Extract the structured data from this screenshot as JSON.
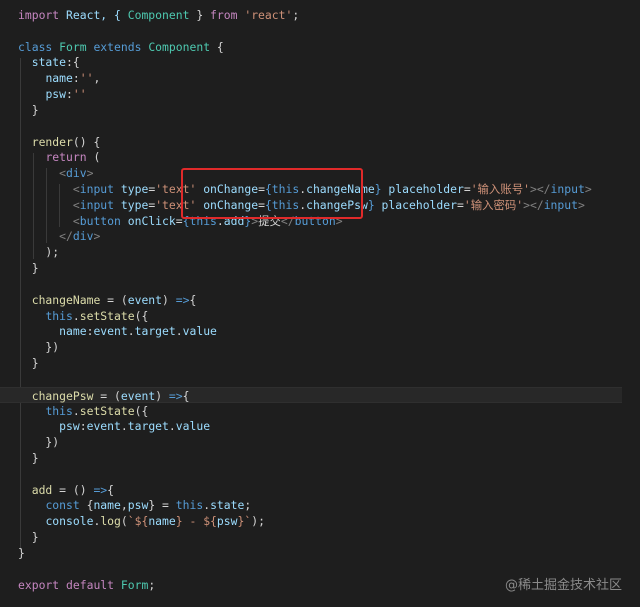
{
  "colors": {
    "background": "#1e1e1e",
    "keyword": "#569cd6",
    "control": "#c586c0",
    "type": "#4ec9b0",
    "variable": "#9cdcfe",
    "function": "#dcdcaa",
    "string": "#ce9178",
    "text": "#d4d4d4",
    "tag": "#569cd6",
    "tag_bracket": "#808080",
    "highlight_box": "#e02a2a"
  },
  "code_lines": [
    [
      [
        "import",
        "control"
      ],
      [
        " React, { ",
        "variable"
      ],
      [
        "Component",
        "type"
      ],
      [
        " } ",
        "text"
      ],
      [
        "from",
        "control"
      ],
      [
        " ",
        "text"
      ],
      [
        "'react'",
        "string"
      ],
      [
        ";",
        "text"
      ]
    ],
    [],
    [
      [
        "class",
        "keyword"
      ],
      [
        " ",
        "text"
      ],
      [
        "Form",
        "type"
      ],
      [
        " ",
        "text"
      ],
      [
        "extends",
        "keyword"
      ],
      [
        " ",
        "text"
      ],
      [
        "Component",
        "type"
      ],
      [
        " {",
        "text"
      ]
    ],
    [
      [
        "  ",
        "text"
      ],
      [
        "state",
        "variable"
      ],
      [
        ":{",
        "text"
      ]
    ],
    [
      [
        "    ",
        "text"
      ],
      [
        "name",
        "variable"
      ],
      [
        ":",
        "text"
      ],
      [
        "''",
        "string"
      ],
      [
        ",",
        "text"
      ]
    ],
    [
      [
        "    ",
        "text"
      ],
      [
        "psw",
        "variable"
      ],
      [
        ":",
        "text"
      ],
      [
        "''",
        "string"
      ]
    ],
    [
      [
        "  }",
        "text"
      ]
    ],
    [],
    [
      [
        "  ",
        "text"
      ],
      [
        "render",
        "function"
      ],
      [
        "() {",
        "text"
      ]
    ],
    [
      [
        "    ",
        "text"
      ],
      [
        "return",
        "control"
      ],
      [
        " (",
        "text"
      ]
    ],
    [
      [
        "      ",
        "text"
      ],
      [
        "<",
        "tag_bracket"
      ],
      [
        "div",
        "tag"
      ],
      [
        ">",
        "tag_bracket"
      ]
    ],
    [
      [
        "        ",
        "text"
      ],
      [
        "<",
        "tag_bracket"
      ],
      [
        "input",
        "tag"
      ],
      [
        " ",
        "text"
      ],
      [
        "type",
        "variable"
      ],
      [
        "=",
        "text"
      ],
      [
        "'text'",
        "string"
      ],
      [
        " ",
        "text"
      ],
      [
        "onChange",
        "variable"
      ],
      [
        "=",
        "text"
      ],
      [
        "{",
        "keyword"
      ],
      [
        "this",
        "keyword"
      ],
      [
        ".",
        "text"
      ],
      [
        "changeName",
        "variable"
      ],
      [
        "}",
        "keyword"
      ],
      [
        " ",
        "text"
      ],
      [
        "placeholder",
        "variable"
      ],
      [
        "=",
        "text"
      ],
      [
        "'输入账号'",
        "string"
      ],
      [
        ">",
        "tag_bracket"
      ],
      [
        "</",
        "tag_bracket"
      ],
      [
        "input",
        "tag"
      ],
      [
        ">",
        "tag_bracket"
      ]
    ],
    [
      [
        "        ",
        "text"
      ],
      [
        "<",
        "tag_bracket"
      ],
      [
        "input",
        "tag"
      ],
      [
        " ",
        "text"
      ],
      [
        "type",
        "variable"
      ],
      [
        "=",
        "text"
      ],
      [
        "'text'",
        "string"
      ],
      [
        " ",
        "text"
      ],
      [
        "onChange",
        "variable"
      ],
      [
        "=",
        "text"
      ],
      [
        "{",
        "keyword"
      ],
      [
        "this",
        "keyword"
      ],
      [
        ".",
        "text"
      ],
      [
        "changePsw",
        "variable"
      ],
      [
        "}",
        "keyword"
      ],
      [
        " ",
        "text"
      ],
      [
        "placeholder",
        "variable"
      ],
      [
        "=",
        "text"
      ],
      [
        "'输入密码'",
        "string"
      ],
      [
        ">",
        "tag_bracket"
      ],
      [
        "</",
        "tag_bracket"
      ],
      [
        "input",
        "tag"
      ],
      [
        ">",
        "tag_bracket"
      ]
    ],
    [
      [
        "        ",
        "text"
      ],
      [
        "<",
        "tag_bracket"
      ],
      [
        "button",
        "tag"
      ],
      [
        " ",
        "text"
      ],
      [
        "onClick",
        "variable"
      ],
      [
        "=",
        "text"
      ],
      [
        "{",
        "keyword"
      ],
      [
        "this",
        "keyword"
      ],
      [
        ".",
        "text"
      ],
      [
        "add",
        "variable"
      ],
      [
        "}",
        "keyword"
      ],
      [
        ">",
        "tag_bracket"
      ],
      [
        "提交",
        "text"
      ],
      [
        "</",
        "tag_bracket"
      ],
      [
        "button",
        "tag"
      ],
      [
        ">",
        "tag_bracket"
      ]
    ],
    [
      [
        "      ",
        "text"
      ],
      [
        "</",
        "tag_bracket"
      ],
      [
        "div",
        "tag"
      ],
      [
        ">",
        "tag_bracket"
      ]
    ],
    [
      [
        "    );",
        "text"
      ]
    ],
    [
      [
        "  }",
        "text"
      ]
    ],
    [],
    [
      [
        "  ",
        "text"
      ],
      [
        "changeName",
        "function"
      ],
      [
        " = (",
        "text"
      ],
      [
        "event",
        "variable"
      ],
      [
        ") ",
        "text"
      ],
      [
        "=>",
        "keyword"
      ],
      [
        "{",
        "text"
      ]
    ],
    [
      [
        "    ",
        "text"
      ],
      [
        "this",
        "keyword"
      ],
      [
        ".",
        "text"
      ],
      [
        "setState",
        "function"
      ],
      [
        "({",
        "text"
      ]
    ],
    [
      [
        "      ",
        "text"
      ],
      [
        "name",
        "variable"
      ],
      [
        ":",
        "text"
      ],
      [
        "event",
        "variable"
      ],
      [
        ".",
        "text"
      ],
      [
        "target",
        "variable"
      ],
      [
        ".",
        "text"
      ],
      [
        "value",
        "variable"
      ]
    ],
    [
      [
        "    })",
        "text"
      ]
    ],
    [
      [
        "  }",
        "text"
      ]
    ],
    [],
    [
      [
        "  ",
        "text"
      ],
      [
        "changePsw",
        "function"
      ],
      [
        " = (",
        "text"
      ],
      [
        "event",
        "variable"
      ],
      [
        ") ",
        "text"
      ],
      [
        "=>",
        "keyword"
      ],
      [
        "{",
        "text"
      ]
    ],
    [
      [
        "    ",
        "text"
      ],
      [
        "this",
        "keyword"
      ],
      [
        ".",
        "text"
      ],
      [
        "setState",
        "function"
      ],
      [
        "({",
        "text"
      ]
    ],
    [
      [
        "      ",
        "text"
      ],
      [
        "psw",
        "variable"
      ],
      [
        ":",
        "text"
      ],
      [
        "event",
        "variable"
      ],
      [
        ".",
        "text"
      ],
      [
        "target",
        "variable"
      ],
      [
        ".",
        "text"
      ],
      [
        "value",
        "variable"
      ]
    ],
    [
      [
        "    })",
        "text"
      ]
    ],
    [
      [
        "  }",
        "text"
      ]
    ],
    [],
    [
      [
        "  ",
        "text"
      ],
      [
        "add",
        "function"
      ],
      [
        " = () ",
        "text"
      ],
      [
        "=>",
        "keyword"
      ],
      [
        "{",
        "text"
      ]
    ],
    [
      [
        "    ",
        "text"
      ],
      [
        "const",
        "keyword"
      ],
      [
        " {",
        "text"
      ],
      [
        "name",
        "variable"
      ],
      [
        ",",
        "text"
      ],
      [
        "psw",
        "variable"
      ],
      [
        "} = ",
        "text"
      ],
      [
        "this",
        "keyword"
      ],
      [
        ".",
        "text"
      ],
      [
        "state",
        "variable"
      ],
      [
        ";",
        "text"
      ]
    ],
    [
      [
        "    ",
        "text"
      ],
      [
        "console",
        "variable"
      ],
      [
        ".",
        "text"
      ],
      [
        "log",
        "function"
      ],
      [
        "(",
        "text"
      ],
      [
        "`${",
        "string"
      ],
      [
        "name",
        "variable"
      ],
      [
        "} - ${",
        "string"
      ],
      [
        "psw",
        "variable"
      ],
      [
        "}`",
        "string"
      ],
      [
        ");",
        "text"
      ]
    ],
    [
      [
        "  }",
        "text"
      ]
    ],
    [
      [
        "}",
        "text"
      ]
    ],
    [],
    [
      [
        "export",
        "control"
      ],
      [
        " ",
        "text"
      ],
      [
        "default",
        "control"
      ],
      [
        " ",
        "text"
      ],
      [
        "Form",
        "type"
      ],
      [
        ";",
        "text"
      ]
    ]
  ],
  "active_line": 24,
  "watermark": "@稀土掘金技术社区"
}
